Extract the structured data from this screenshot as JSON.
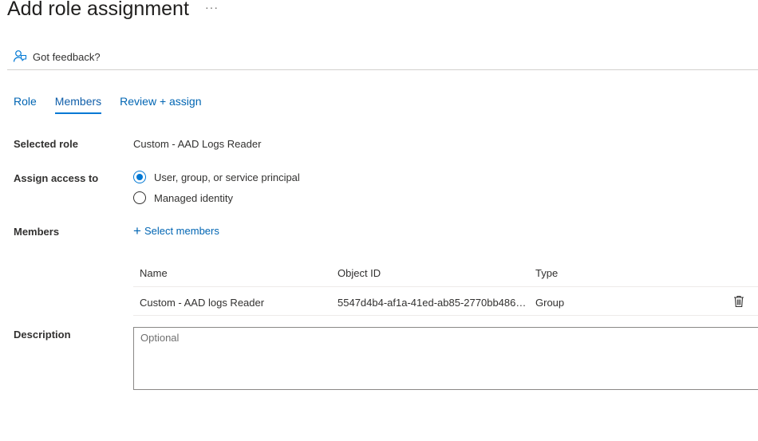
{
  "page": {
    "title": "Add role assignment",
    "more_label": "···",
    "feedback_label": "Got feedback?"
  },
  "tabs": [
    {
      "label": "Role",
      "active": false
    },
    {
      "label": "Members",
      "active": true
    },
    {
      "label": "Review + assign",
      "active": false
    }
  ],
  "selected_role": {
    "label": "Selected role",
    "value": "Custom - AAD Logs Reader"
  },
  "assign_access": {
    "label": "Assign access to",
    "options": [
      {
        "label": "User, group, or service principal",
        "checked": true
      },
      {
        "label": "Managed identity",
        "checked": false
      }
    ]
  },
  "members": {
    "label": "Members",
    "select_label": "Select members",
    "columns": [
      "Name",
      "Object ID",
      "Type"
    ],
    "rows": [
      {
        "name": "Custom - AAD logs Reader",
        "object_id": "5547d4b4-af1a-41ed-ab85-2770bb486…",
        "type": "Group",
        "action_icon": "trash-icon"
      }
    ]
  },
  "description": {
    "label": "Description",
    "placeholder": "Optional",
    "value": ""
  },
  "colors": {
    "accent": "#0078d4",
    "link": "#0065b3",
    "text": "#323130"
  }
}
